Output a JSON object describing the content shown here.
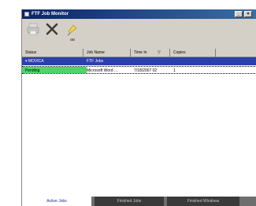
{
  "window": {
    "title": "FTF Job Monitor",
    "minimize": "_",
    "close": "×"
  },
  "toolbar": {
    "items": [
      {
        "name": "printer",
        "label": "",
        "enabled": false
      },
      {
        "name": "delete",
        "label": "",
        "enabled": true
      },
      {
        "name": "pin",
        "label": "",
        "enabled": true
      }
    ],
    "hint_label": "oo"
  },
  "table": {
    "columns": [
      "Status",
      "Job Name",
      "Time In",
      "Copies"
    ],
    "sort_indicator": "▽",
    "group_row": {
      "status": "▾ MOVICA",
      "job_name": "FTF Jobs",
      "time_in": "",
      "copies": ""
    },
    "rows": [
      {
        "status": "Pending",
        "job_name": "Microsoft Word ...",
        "time_in": "7/18/2007 02",
        "copies": "1"
      }
    ]
  },
  "tabs": [
    {
      "label": "Active Jobs",
      "active": true
    },
    {
      "label": "Finished Jobs",
      "active": false
    },
    {
      "label": "Finished Windows",
      "active": false
    }
  ],
  "colors": {
    "title_start": "#0a246a",
    "title_end": "#3a6ea5",
    "group_row_bg": "#2b3fae",
    "pending_status_bg": "#4ad66a",
    "tab_strip_bg": "#6e6e6e"
  }
}
